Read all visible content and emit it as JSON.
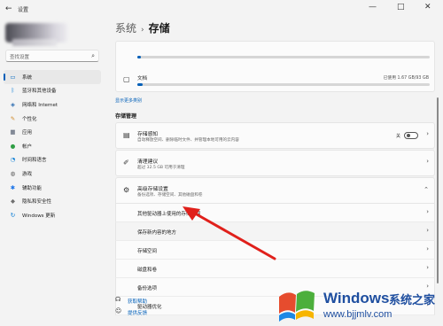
{
  "window": {
    "title": "设置",
    "back_glyph": "←",
    "minimize_glyph": "—",
    "maximize_glyph": "□",
    "close_glyph": "✕"
  },
  "sidebar": {
    "search_placeholder": "查找设置",
    "search_glyph": "⌕",
    "items": [
      {
        "label": "系统",
        "icon": "monitor-icon",
        "glyph": "▭",
        "color": "#0067c0",
        "active": true
      },
      {
        "label": "蓝牙和其他设备",
        "icon": "bluetooth-icon",
        "glyph": "ᛒ",
        "color": "#0078d4",
        "active": false
      },
      {
        "label": "网络和 Internet",
        "icon": "wifi-icon",
        "glyph": "◈",
        "color": "#2b6cb0",
        "active": false
      },
      {
        "label": "个性化",
        "icon": "brush-icon",
        "glyph": "✎",
        "color": "#d08a2a",
        "active": false
      },
      {
        "label": "应用",
        "icon": "apps-icon",
        "glyph": "▦",
        "color": "#4a5568",
        "active": false
      },
      {
        "label": "帐户",
        "icon": "account-icon",
        "glyph": "●",
        "color": "#2f9e44",
        "active": false
      },
      {
        "label": "时间和语言",
        "icon": "clock-globe-icon",
        "glyph": "◔",
        "color": "#0078d4",
        "active": false
      },
      {
        "label": "游戏",
        "icon": "gamepad-icon",
        "glyph": "◍",
        "color": "#555555",
        "active": false
      },
      {
        "label": "辅助功能",
        "icon": "accessibility-icon",
        "glyph": "✱",
        "color": "#1a73e8",
        "active": false
      },
      {
        "label": "隐私和安全性",
        "icon": "shield-icon",
        "glyph": "◆",
        "color": "#707070",
        "active": false
      },
      {
        "label": "Windows 更新",
        "icon": "update-icon",
        "glyph": "↻",
        "color": "#0078d4",
        "active": false
      }
    ]
  },
  "breadcrumb": {
    "parent": "系统",
    "separator": "›",
    "current": "存储"
  },
  "storage": {
    "documents_label": "文档",
    "documents_size": "已使用 1.67 GB/93 GB",
    "documents_usage": 0.018,
    "documents_glyph": "▢",
    "more_categories": "显示更多类别"
  },
  "management": {
    "section_title": "存储管理",
    "storage_sense": {
      "title": "存储感知",
      "desc": "自动释放空间、删除临时文件、并管理本地可用的云内容",
      "toggle_label": "关",
      "toggle_on": false,
      "glyph": "▤"
    },
    "cleanup": {
      "title": "清理建议",
      "desc": "超过 32.5 GB 可用于清理",
      "glyph": "✐"
    },
    "advanced": {
      "title": "高级存储设置",
      "desc": "备份选项、存储空间、其他磁盘和卷",
      "glyph": "⚙",
      "expanded": true,
      "expand_glyph": "⌃",
      "items": [
        "其他驱动器上使用的存储空间",
        "保存新内容的地方",
        "存储空间",
        "磁盘和卷",
        "备份选项",
        "驱动器优化"
      ]
    },
    "chevron": "›"
  },
  "footer": {
    "help_label": "获取帮助",
    "help_glyph": "☊",
    "feedback_label": "提供反馈",
    "feedback_glyph": "☺"
  },
  "watermark": {
    "brand": "Windows",
    "cn": "系统之家",
    "url": "www.bjjmlv.com"
  },
  "annotation": {
    "arrow_color": "#e0201b"
  }
}
